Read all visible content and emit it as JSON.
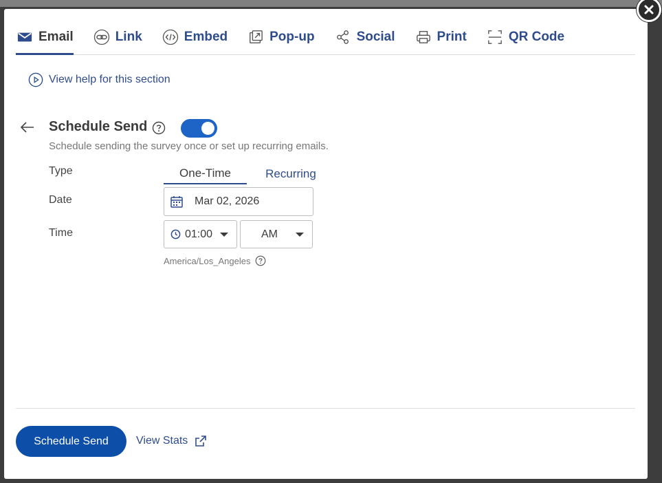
{
  "tabs": [
    {
      "label": "Email",
      "icon": "envelope-icon"
    },
    {
      "label": "Link",
      "icon": "link-icon"
    },
    {
      "label": "Embed",
      "icon": "code-icon"
    },
    {
      "label": "Pop-up",
      "icon": "popup-icon"
    },
    {
      "label": "Social",
      "icon": "share-icon"
    },
    {
      "label": "Print",
      "icon": "printer-icon"
    },
    {
      "label": "QR Code",
      "icon": "qr-scan-icon"
    }
  ],
  "help": {
    "label": "View help for this section"
  },
  "schedule": {
    "title": "Schedule Send",
    "enabled": true,
    "subtitle": "Schedule sending the survey once or set up recurring emails.",
    "type_label": "Type",
    "type_options": [
      "One-Time",
      "Recurring"
    ],
    "selected_type": "One-Time",
    "date_label": "Date",
    "date_value": "Mar 02, 2026",
    "time_label": "Time",
    "hour_value": "01:00",
    "ampm_value": "AM",
    "timezone": "America/Los_Angeles"
  },
  "footer": {
    "primary_label": "Schedule Send",
    "stats_label": "View Stats"
  },
  "colors": {
    "accent": "#2e4c8c",
    "primary_button": "#0d4fa8",
    "toggle_on": "#1e63c6"
  }
}
